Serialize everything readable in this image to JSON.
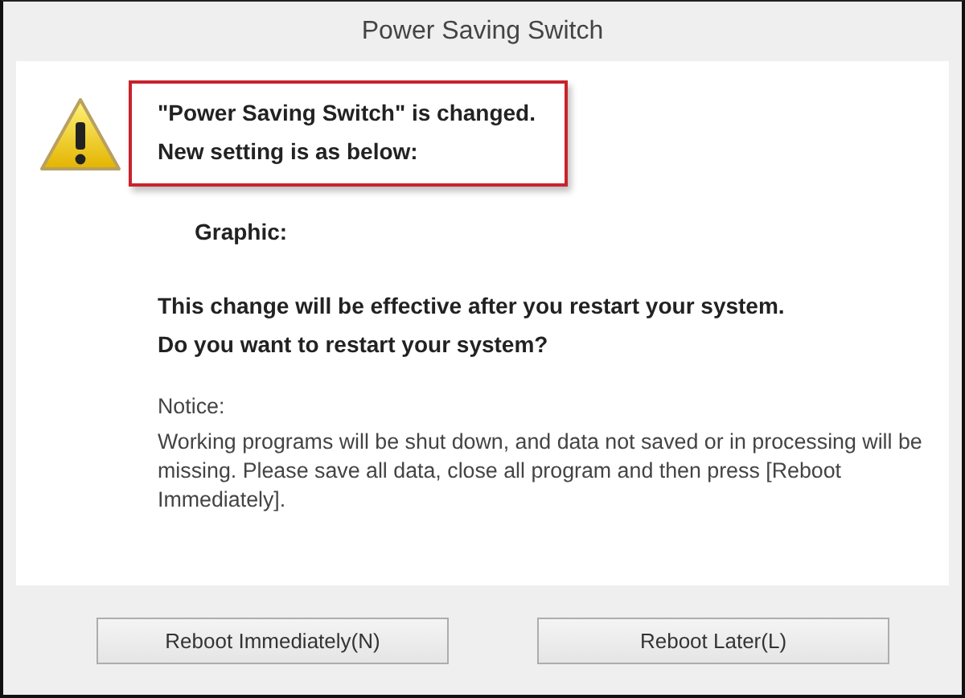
{
  "window": {
    "title": "Power Saving Switch"
  },
  "message": {
    "lines": [
      "\"Power Saving Switch\" is changed.",
      "New setting is as below:"
    ],
    "highlighted": true
  },
  "setting_label": "Graphic:",
  "prompt": [
    "This change will be effective after you restart your system.",
    "Do you want to restart your system?"
  ],
  "notice": {
    "heading": "Notice:",
    "text": "Working programs will be shut down, and data not saved or in processing will be missing. Please save all data, close all program and then press [Reboot Immediately]."
  },
  "buttons": [
    {
      "label": "Reboot Immediately(N)"
    },
    {
      "label": "Reboot Later(L)"
    }
  ]
}
